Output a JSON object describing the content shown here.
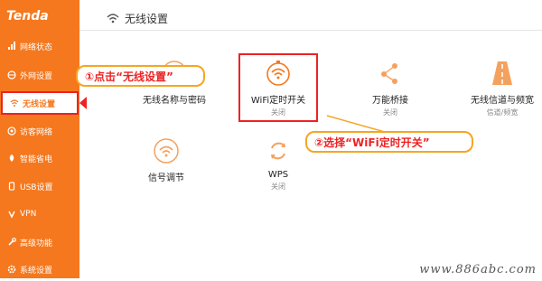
{
  "brand": {
    "logo": "Tenda"
  },
  "sidebar": {
    "items": [
      {
        "label": "网络状态",
        "icon": "network-status-icon"
      },
      {
        "label": "外网设置",
        "icon": "globe-icon"
      },
      {
        "label": "无线设置",
        "icon": "wifi-icon",
        "active": true
      },
      {
        "label": "访客网络",
        "icon": "guest-icon"
      },
      {
        "label": "智能省电",
        "icon": "power-save-icon"
      },
      {
        "label": "USB设置",
        "icon": "usb-icon"
      },
      {
        "label": "VPN",
        "icon": "vpn-icon"
      },
      {
        "label": "高级功能",
        "icon": "wrench-icon"
      },
      {
        "label": "系统设置",
        "icon": "gear-icon"
      }
    ]
  },
  "header": {
    "title": "无线设置",
    "icon": "wifi-icon"
  },
  "tiles": [
    {
      "title": "无线名称与密码",
      "status": "",
      "icon": "wifi-password-icon"
    },
    {
      "title": "WiFi定时开关",
      "status": "关闭",
      "icon": "wifi-timer-icon"
    },
    {
      "title": "万能桥接",
      "status": "关闭",
      "icon": "bridge-icon"
    },
    {
      "title": "无线信道与频宽",
      "status": "信道/频宽",
      "icon": "channel-road-icon"
    },
    {
      "title": "信号调节",
      "status": "",
      "icon": "signal-adjust-icon"
    },
    {
      "title": "WPS",
      "status": "关闭",
      "icon": "wps-icon"
    }
  ],
  "annotations": {
    "step1": "①点击“无线设置”",
    "step2": "②选择“WiFi定时开关”"
  },
  "colors": {
    "sidebar": "#f5781e",
    "accent": "#f5781e",
    "annotation_red": "#e22222",
    "callout_border": "#f5a623"
  },
  "watermark": "www.886abc.com"
}
